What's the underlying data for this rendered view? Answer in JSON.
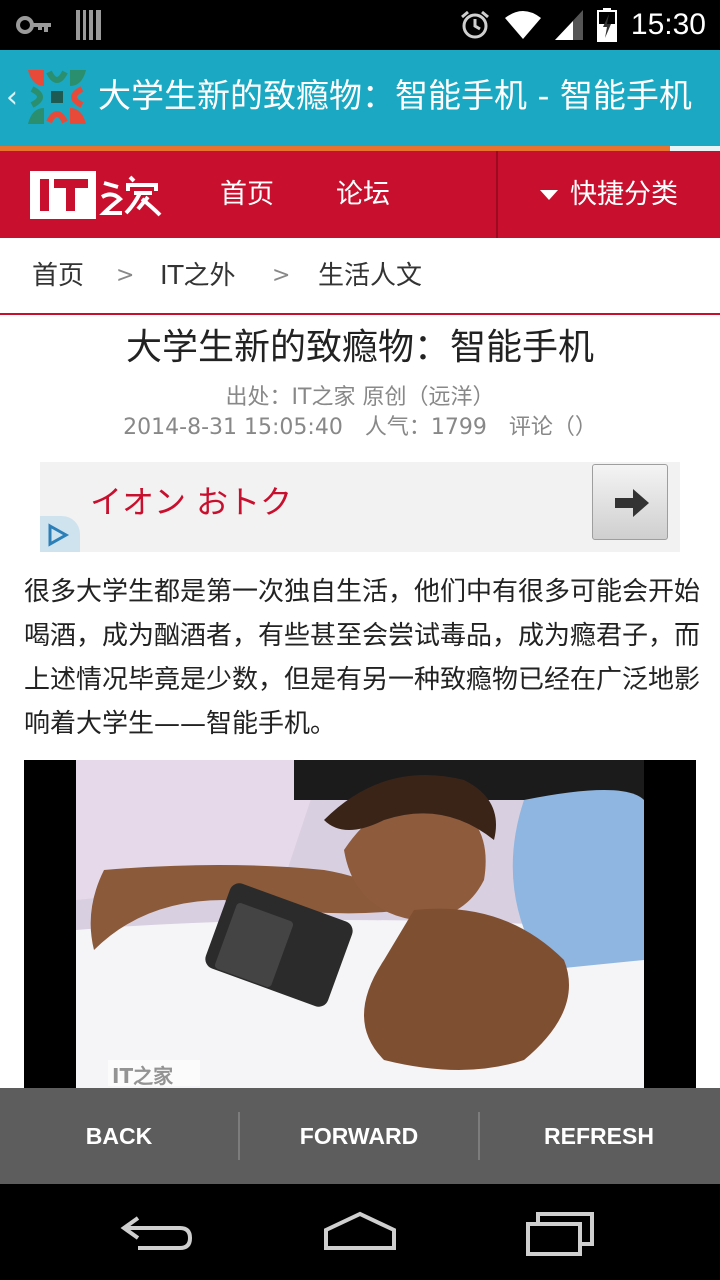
{
  "status_bar": {
    "time": "15:30",
    "icons": [
      "key-icon",
      "barcode-icon",
      "alarm-icon",
      "wifi-icon",
      "signal-icon",
      "battery-charging-icon"
    ]
  },
  "app_bar": {
    "title": "大学生新的致瘾物：智能手机 - 智能手机",
    "back_icon": "chevron-left-icon",
    "logo_icon": "ithome-app-logo"
  },
  "load_progress": {
    "fraction": 0.93
  },
  "site_header": {
    "logo_text": "IT之家",
    "nav": [
      "首页",
      "论坛"
    ],
    "quick_category": "快捷分类",
    "colors": {
      "brand_red": "#c8102e",
      "app_bar_teal": "#1aa8c2",
      "progress_orange": "#e9722d"
    }
  },
  "breadcrumb": {
    "items": [
      "首页",
      "IT之外",
      "生活人文"
    ],
    "separator": ">"
  },
  "article": {
    "title": "大学生新的致瘾物：智能手机",
    "source": "出处：IT之家 原创（远洋）",
    "meta": "2014-8-31 15:05:40　人气：1799　评论（）",
    "body": "很多大学生都是第一次独自生活，他们中有很多可能会开始喝酒，成为酗酒者，有些甚至会尝试毒品，成为瘾君子，而上述情况毕竟是少数，但是有另一种致瘾物已经在广泛地影响着大学生——智能手机。",
    "image_watermark": "IT之家"
  },
  "ad": {
    "text": "イオン おトク",
    "arrow_icon": "arrow-right-icon",
    "choices_icon": "adchoices-icon"
  },
  "browser_toolbar": {
    "back": "BACK",
    "forward": "FORWARD",
    "refresh": "REFRESH"
  },
  "nav_bar": {
    "icons": [
      "back-nav-icon",
      "home-nav-icon",
      "recents-nav-icon"
    ]
  }
}
